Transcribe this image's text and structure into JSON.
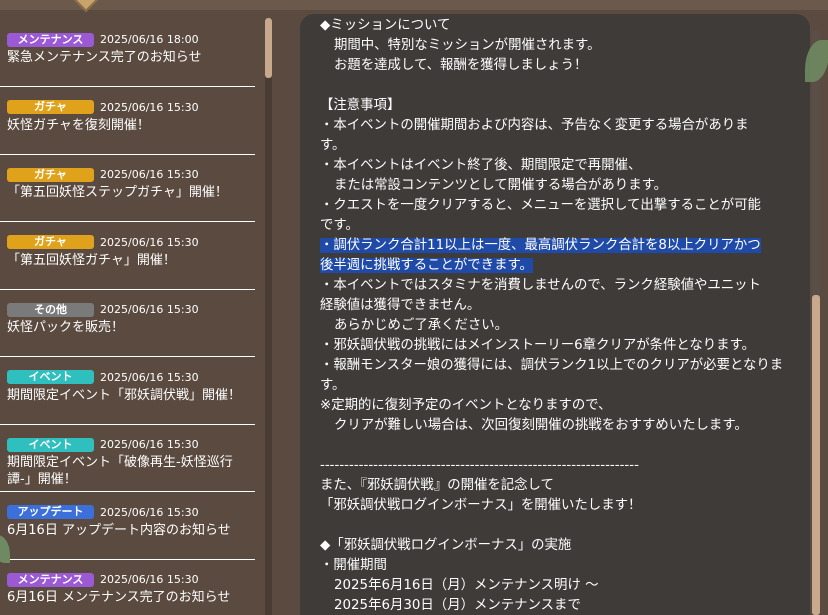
{
  "colors": {
    "maintenance": "#9b59d6",
    "gacha": "#e0a21b",
    "other": "#7a7a7a",
    "event": "#2fbfbe",
    "update": "#3b6fd9"
  },
  "news": [
    {
      "category": "メンテナンス",
      "type": "maintenance",
      "date": "2025/06/16 18:00",
      "title": "緊急メンテナンス完了のお知らせ"
    },
    {
      "category": "ガチャ",
      "type": "gacha",
      "date": "2025/06/16 15:30",
      "title": "妖怪ガチャを復刻開催！"
    },
    {
      "category": "ガチャ",
      "type": "gacha",
      "date": "2025/06/16 15:30",
      "title": "「第五回妖怪ステップガチャ」開催！"
    },
    {
      "category": "ガチャ",
      "type": "gacha",
      "date": "2025/06/16 15:30",
      "title": "「第五回妖怪ガチャ」開催！"
    },
    {
      "category": "その他",
      "type": "other",
      "date": "2025/06/16 15:30",
      "title": "妖怪パックを販売！"
    },
    {
      "category": "イベント",
      "type": "event",
      "date": "2025/06/16 15:30",
      "title": "期間限定イベント「邪妖調伏戦」開催！"
    },
    {
      "category": "イベント",
      "type": "event",
      "date": "2025/06/16 15:30",
      "title": "期間限定イベント「破像再生-妖怪巡行譚-」開催！"
    },
    {
      "category": "アップデート",
      "type": "update",
      "date": "2025/06/16 15:30",
      "title": "6月16日 アップデート内容のお知らせ"
    },
    {
      "category": "メンテナンス",
      "type": "maintenance",
      "date": "2025/06/16 15:30",
      "title": "6月16日 メンテナンス完了のお知らせ"
    }
  ],
  "detail": {
    "lines": [
      "◆ミッションについて",
      "期間中、特別なミッションが開催されます。",
      "お題を達成して、報酬を獲得しましょう！",
      "",
      "【注意事項】",
      "・本イベントの開催期間および内容は、予告なく変更する場合がありま",
      "す。",
      "・本イベントはイベント終了後、期間限定で再開催、",
      "または常設コンテンツとして開催する場合があります。",
      "・クエストを一度クリアすると、メニューを選択して出撃することが可能",
      "です。",
      "・調伏ランク合計11以上は一度、最高調伏ランク合計を8以上クリアかつ",
      "後半週に挑戦することができます。",
      "・本イベントではスタミナを消費しませんので、ランク経験値やユニット",
      "経験値は獲得できません。",
      "あらかじめご了承ください。",
      "・邪妖調伏戦の挑戦にはメインストーリー6章クリアが条件となります。",
      "・報酬モンスター娘の獲得には、調伏ランク1以上でのクリアが必要となりま",
      "す。",
      "※定期的に復刻予定のイベントとなりますので、",
      "クリアが難しい場合は、次回復刻開催の挑戦をおすすめいたします。",
      "",
      "------------------------------------------------------------------",
      "また、『邪妖調伏戦』の開催を記念して",
      "「邪妖調伏戦ログインボーナス」を開催いたします！",
      "",
      "◆「邪妖調伏戦ログインボーナス」の実施",
      "・開催期間",
      "2025年6月16日（月）メンテナンス明け ～",
      "2025年6月30日（月）メンテナンスまで"
    ]
  }
}
